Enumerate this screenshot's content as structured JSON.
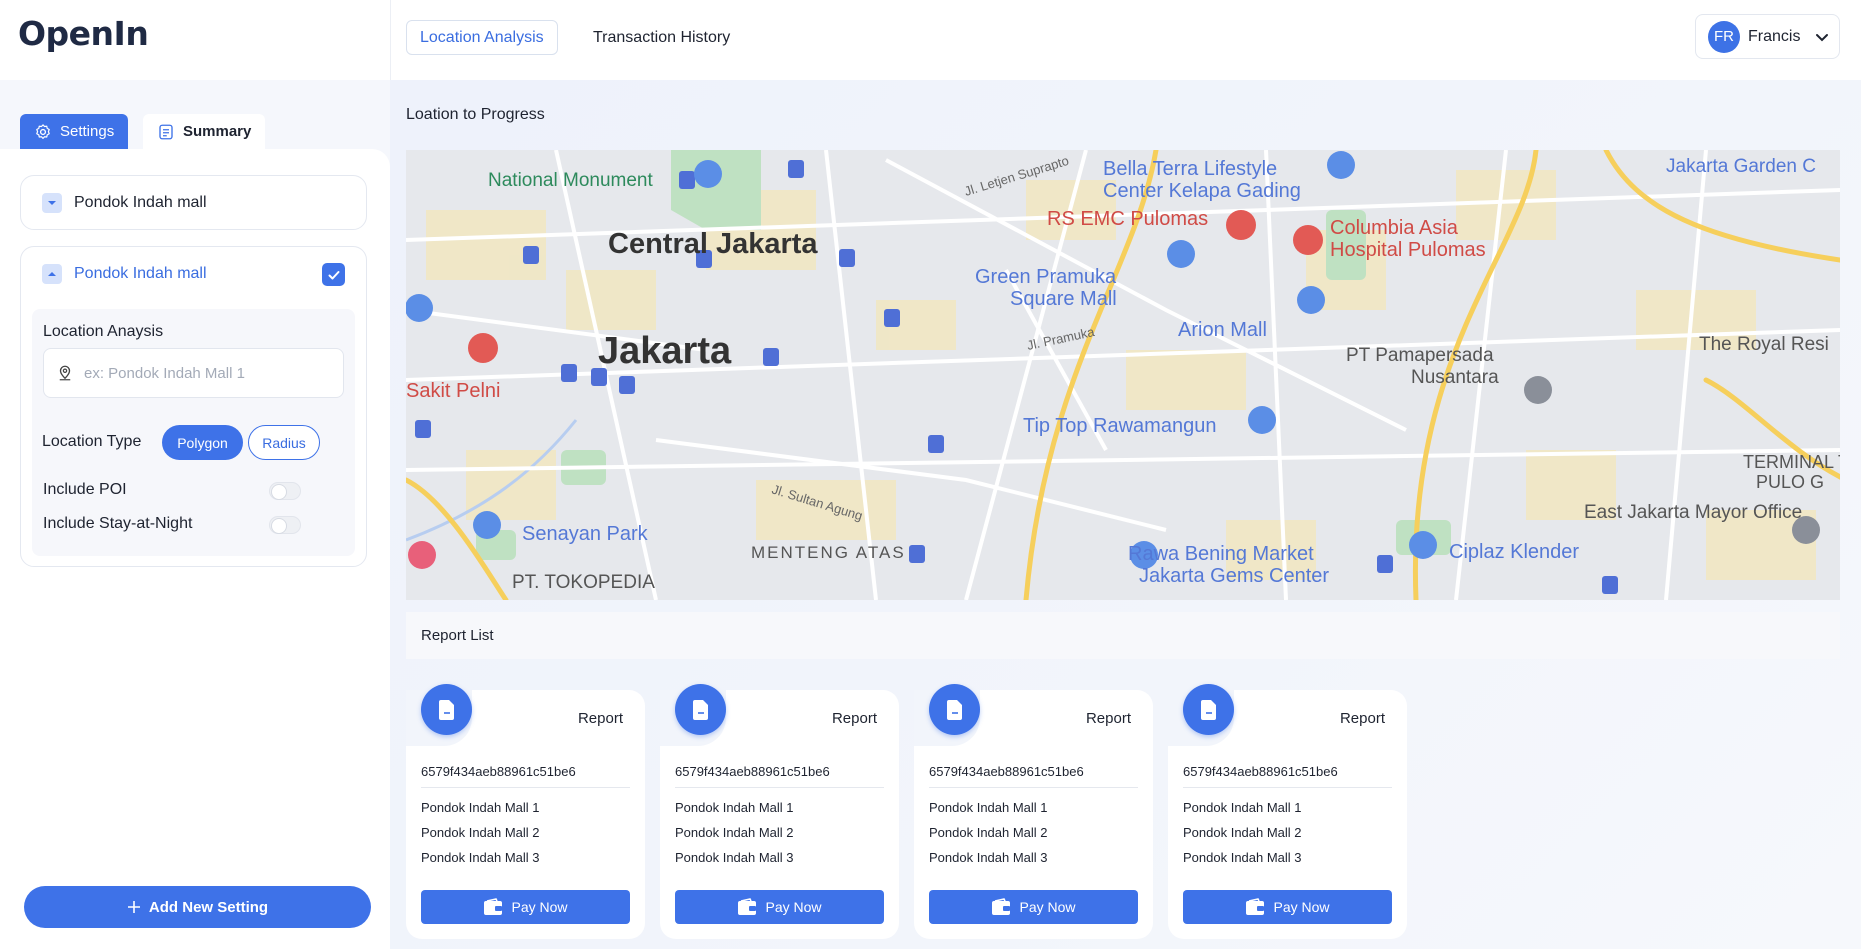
{
  "app": {
    "logo_text": "OpenIn"
  },
  "header": {
    "tabs": [
      {
        "label": "Location Analysis",
        "active": true
      },
      {
        "label": "Transaction History",
        "active": false
      }
    ],
    "user": {
      "initials": "FR",
      "name": "Francis"
    }
  },
  "sidebar": {
    "tabs": [
      {
        "label": "Settings",
        "icon": "gear-icon",
        "active": true
      },
      {
        "label": "Summary",
        "icon": "document-icon",
        "active": false
      }
    ],
    "settings": [
      {
        "name": "Pondok Indah mall",
        "expanded": false
      },
      {
        "name": "Pondok Indah mall",
        "expanded": true,
        "checked": true
      }
    ],
    "form": {
      "location_label": "Location Anaysis",
      "search_placeholder": "ex: Pondok Indah Mall 1",
      "type_label": "Location Type",
      "type_options": [
        "Polygon",
        "Radius"
      ],
      "type_selected": "Polygon",
      "include_poi_label": "Include POI",
      "include_poi": false,
      "include_night_label": "Include Stay-at-Night",
      "include_night": false
    },
    "add_button": "Add New Setting"
  },
  "main": {
    "title": "Loation to Progress",
    "map": {
      "labels": [
        "National Monument",
        "Central Jakarta",
        "Jakarta",
        "Bella Terra Lifestyle",
        "Center Kelapa Gading",
        "RS EMC Pulomas",
        "Columbia Asia",
        "Hospital Pulomas",
        "Green Pramuka",
        "Square Mall",
        "Arion Mall",
        "PT Pamapersada",
        "Nusantara",
        "The Royal Resi",
        "Tip Top Rawamangun",
        "Sakit Pelni",
        "Senayan Park",
        "MENTENG ATAS",
        "Rawa Bening Market",
        "Jakarta Gems Center",
        "Ciplaz Klender",
        "East Jakarta Mayor Office",
        "TERMINAL T",
        "PULO G",
        "PT. TOKOPEDIA",
        "Jakarta Garden C",
        "Jl. Letjen Suprapto",
        "Jl. Pramuka",
        "Jl. Sultan Agung"
      ]
    },
    "report_list_title": "Report List",
    "reports": [
      {
        "title": "Report",
        "id": "6579f434aeb88961c51be6",
        "items": [
          "Pondok Indah Mall 1",
          "Pondok Indah Mall 2",
          "Pondok Indah Mall 3"
        ],
        "button": "Pay Now"
      },
      {
        "title": "Report",
        "id": "6579f434aeb88961c51be6",
        "items": [
          "Pondok Indah Mall 1",
          "Pondok Indah Mall 2",
          "Pondok Indah Mall 3"
        ],
        "button": "Pay Now"
      },
      {
        "title": "Report",
        "id": "6579f434aeb88961c51be6",
        "items": [
          "Pondok Indah Mall 1",
          "Pondok Indah Mall 2",
          "Pondok Indah Mall 3"
        ],
        "button": "Pay Now"
      },
      {
        "title": "Report",
        "id": "6579f434aeb88961c51be6",
        "items": [
          "Pondok Indah Mall 1",
          "Pondok Indah Mall 2",
          "Pondok Indah Mall 3"
        ],
        "button": "Pay Now"
      }
    ]
  },
  "colors": {
    "accent": "#3e72e8",
    "map_base": "#e5e7eb",
    "park": "#c8e6c9",
    "road": "#f6cf5c"
  }
}
